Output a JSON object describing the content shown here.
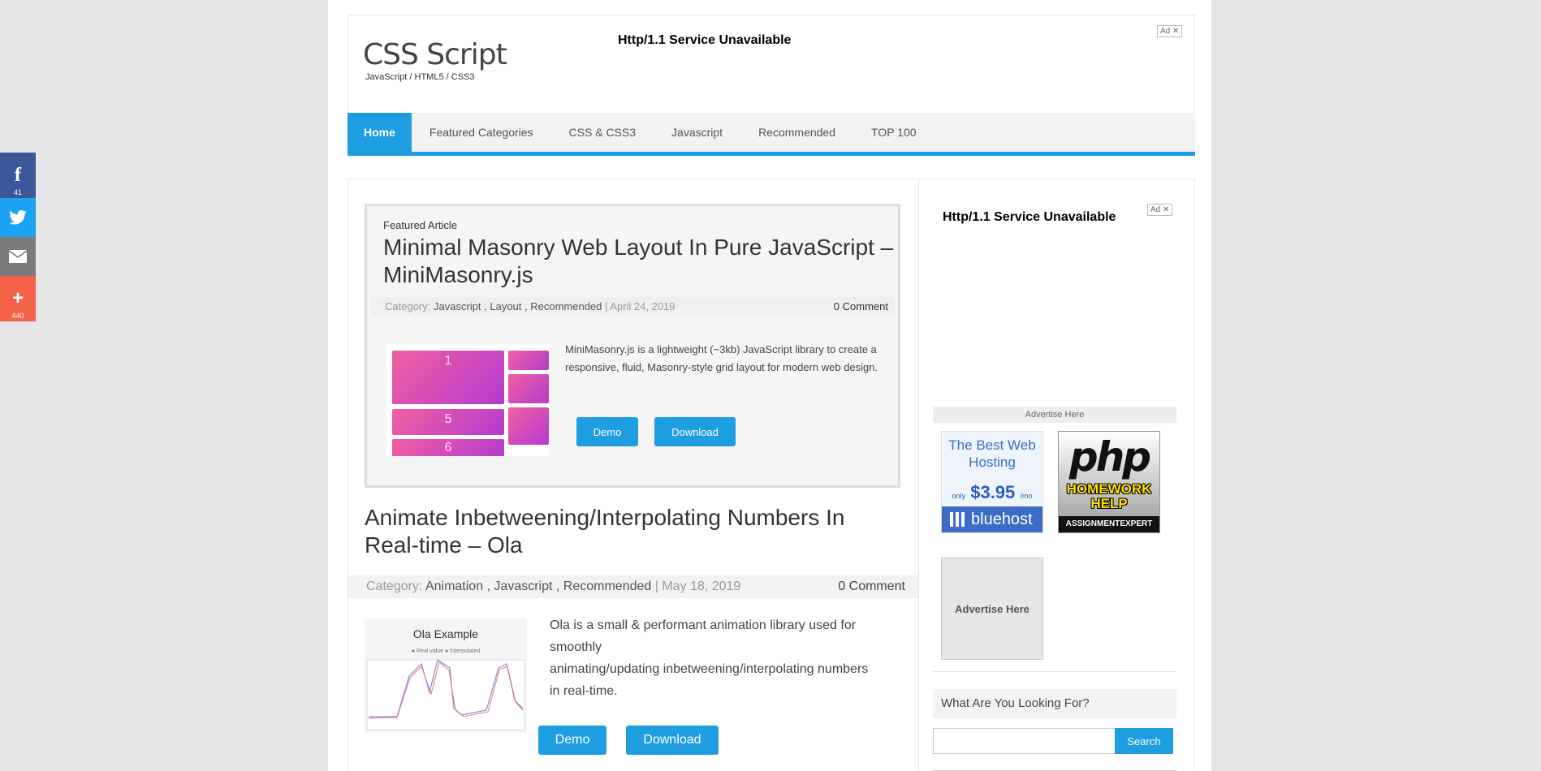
{
  "share": {
    "facebook_count": "41",
    "plus_count": "440"
  },
  "header": {
    "logo": "CSS Script",
    "tagline": "JavaScript / HTML5 / CSS3",
    "ad_text": "Http/1.1 Service Unavailable",
    "ad_badge": "Ad ✕"
  },
  "nav": {
    "items": [
      "Home",
      "Featured Categories",
      "CSS & CSS3",
      "Javascript",
      "Recommended",
      "TOP 100"
    ]
  },
  "featured": {
    "label": "Featured Article",
    "title": "Minimal Masonry Web Layout In Pure JavaScript – MiniMasonry.js",
    "category_prefix": "Category:",
    "categories": "Javascript , Layout , Recommended",
    "date": "| April 24, 2019",
    "comments": "0 Comment",
    "thumb_numbers": [
      "1",
      "5",
      "6"
    ],
    "description": "MiniMasonry.js is a lightweight (~3kb) JavaScript library to create a responsive, fluid, Masonry-style grid layout for modern web design.",
    "demo_label": "Demo",
    "download_label": "Download"
  },
  "post": {
    "title": "Animate Inbetweening/Interpolating Numbers In Real-time – Ola",
    "category_prefix": "Category:",
    "categories": "Animation , Javascript , Recommended",
    "date": "| May 18, 2019",
    "comments": "0 Comment",
    "thumb_title": "Ola Example",
    "thumb_legend": "● Real value   ● Interpolated",
    "description_lines": [
      "Ola is a small & performant animation library used for",
      "smoothly",
      "animating/updating inbetweening/interpolating numbers",
      "in real-time."
    ],
    "demo_label": "Demo",
    "download_label": "Download"
  },
  "sidebar": {
    "ad_text": "Http/1.1 Service Unavailable",
    "ad_badge": "Ad ✕",
    "advertise_bar": "Advertise Here",
    "bluehost": {
      "headline": "The Best Web Hosting",
      "price_prefix": "only",
      "price": "$3.95",
      "price_suffix": "/mo",
      "brand": "bluehost"
    },
    "php": {
      "logo": "php",
      "line1": "HOMEWORK",
      "line2": "HELP",
      "brand": "ASSIGNMENTEXPERT"
    },
    "advertise_box": "Advertise Here",
    "search_heading": "What Are You Looking For?",
    "search_button": "Search"
  },
  "colors": {
    "accent": "#1e9ee0",
    "facebook": "#3b5998",
    "twitter": "#1da1f2",
    "email": "#7a7a7a",
    "plus": "#f36246"
  }
}
